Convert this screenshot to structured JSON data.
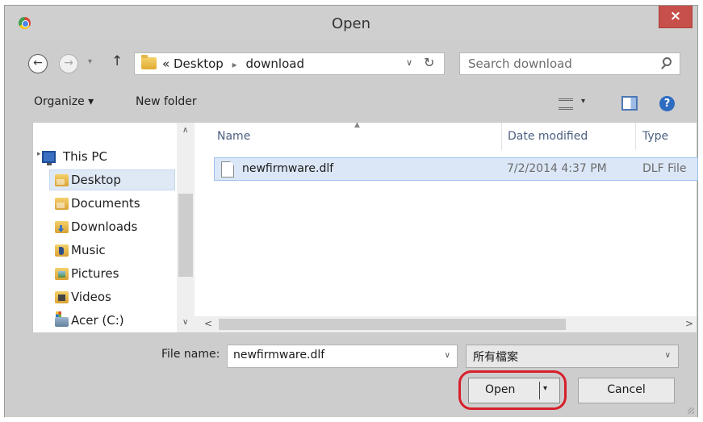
{
  "window": {
    "title": "Open",
    "close_glyph": "×"
  },
  "nav": {
    "back_glyph": "←",
    "forward_glyph": "→",
    "up_glyph": "↑",
    "history_dropdown_glyph": "▾",
    "address": {
      "overflow": "«",
      "separator": "▸",
      "segments": [
        "Desktop",
        "download"
      ],
      "dropdown_glyph": "∨",
      "refresh_glyph": "↻"
    },
    "search_placeholder": "Search download"
  },
  "toolbar": {
    "organize": "Organize ▾",
    "new_folder": "New folder",
    "view_dropdown_glyph": "▾",
    "help_glyph": "?"
  },
  "tree": {
    "items": [
      {
        "label": "This PC",
        "icon": "computer-icon"
      },
      {
        "label": "Desktop",
        "icon": "folder-icon",
        "selected": true
      },
      {
        "label": "Documents",
        "icon": "folder-icon"
      },
      {
        "label": "Downloads",
        "icon": "downloads-folder-icon"
      },
      {
        "label": "Music",
        "icon": "music-folder-icon"
      },
      {
        "label": "Pictures",
        "icon": "pictures-folder-icon"
      },
      {
        "label": "Videos",
        "icon": "videos-folder-icon"
      },
      {
        "label": "Acer (C:)",
        "icon": "drive-icon"
      }
    ],
    "expander_glyph": "▸",
    "scroll_up": "∧",
    "scroll_down": "∨"
  },
  "files": {
    "sort_glyph": "▲",
    "columns": [
      "Name",
      "Date modified",
      "Type"
    ],
    "rows": [
      {
        "name": "newfirmware.dlf",
        "date": "7/2/2014 4:37 PM",
        "type": "DLF File"
      }
    ],
    "scroll_left": "<",
    "scroll_right": ">"
  },
  "bottom": {
    "file_name_label": "File name:",
    "file_name_value": "newfirmware.dlf",
    "file_name_dropdown_glyph": "∨",
    "file_type_value": "所有檔案",
    "file_type_dropdown_glyph": "∨",
    "open_label": "Open",
    "open_dropdown_glyph": "▾",
    "cancel_label": "Cancel"
  },
  "colors": {
    "close_button": "#c7504a",
    "selection": "#dbe7f7",
    "highlight_ring": "#d71f2a",
    "chrome": "#cdcdcd"
  }
}
